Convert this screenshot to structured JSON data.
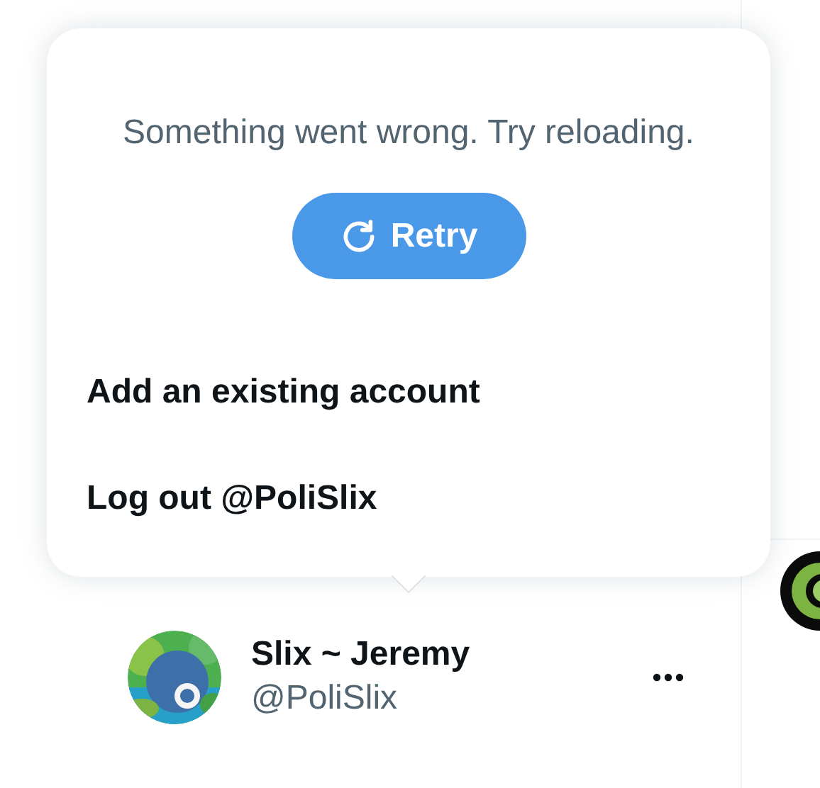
{
  "popup": {
    "message": "Something went wrong. Try reloading.",
    "retry_button": "Retry",
    "items": [
      {
        "label": "Add an existing account"
      },
      {
        "label": "Log out @PoliSlix"
      }
    ]
  },
  "account": {
    "name": "Slix ~ Jeremy",
    "handle": "@PoliSlix"
  }
}
